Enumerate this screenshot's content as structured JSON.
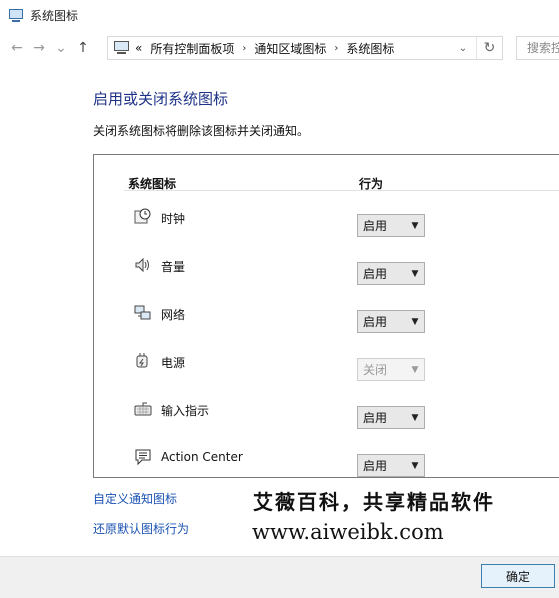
{
  "window": {
    "title": "系统图标"
  },
  "nav": {
    "back": "←",
    "forward": "→",
    "recent": "⌄",
    "up": "↑",
    "breadcrumb_overflow": "«",
    "breadcrumbs": [
      "所有控制面板项",
      "通知区域图标",
      "系统图标"
    ],
    "crumb_separator": "›",
    "refresh": "↻",
    "search_placeholder": "搜索控制面板"
  },
  "main": {
    "heading": "启用或关闭系统图标",
    "description": "关闭系统图标将删除该图标并关闭通知。",
    "columns": {
      "name": "系统图标",
      "behavior": "行为"
    },
    "rows": [
      {
        "name": "时钟",
        "icon": "clock-icon",
        "behavior": "启用",
        "enabled": true
      },
      {
        "name": "音量",
        "icon": "volume-icon",
        "behavior": "启用",
        "enabled": true
      },
      {
        "name": "网络",
        "icon": "network-icon",
        "behavior": "启用",
        "enabled": true
      },
      {
        "name": "电源",
        "icon": "power-icon",
        "behavior": "关闭",
        "enabled": false
      },
      {
        "name": "输入指示",
        "icon": "keyboard-icon",
        "behavior": "启用",
        "enabled": true
      },
      {
        "name": "Action Center",
        "icon": "action-center-icon",
        "behavior": "启用",
        "enabled": true
      }
    ],
    "dropdown_arrow": "▼"
  },
  "links": {
    "customize": "自定义通知图标",
    "restore": "还原默认图标行为"
  },
  "watermark": {
    "chinese": "艾薇百科，共享精品软件",
    "url": "www.aiweibk.com"
  },
  "footer": {
    "ok_label": "确定"
  },
  "colors": {
    "heading": "#1e3287",
    "link": "#1a52b3",
    "button_border": "#3c7fb1"
  }
}
